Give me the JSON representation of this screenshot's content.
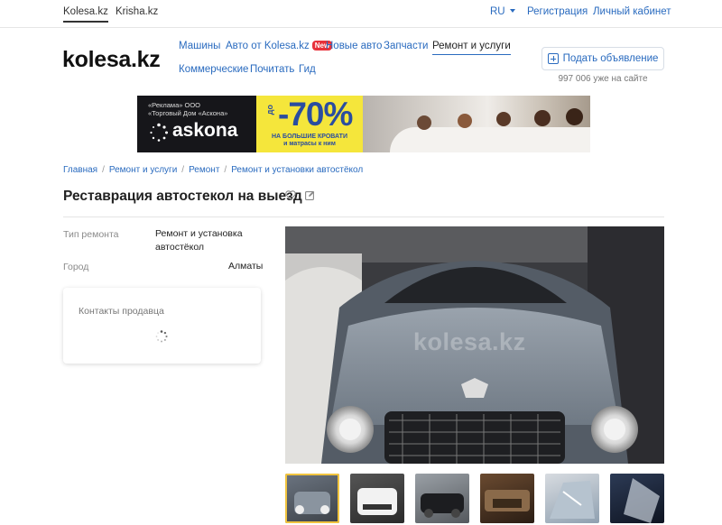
{
  "top_bar": {
    "sites": [
      "Kolesa.kz",
      "Krisha.kz"
    ],
    "language": "RU",
    "register": "Регистрация",
    "account": "Личный кабинет"
  },
  "header": {
    "logo": "kolesa.kz",
    "nav": [
      "Машины",
      "Авто от Kolesa.kz",
      "Новые авто",
      "Запчасти",
      "Ремонт и услуги",
      "Коммерческие",
      "Почитать",
      "Гид"
    ],
    "new_badge": "New",
    "post_button": "Подать объявление",
    "online_count": "997 006 уже на сайте"
  },
  "ad_banner": {
    "small_text_1": "«Реклама» ООО",
    "small_text_2": "«Торговый Дом «Аскона»",
    "brand": "askona",
    "discount_prefix": "до",
    "discount": "-70%",
    "subtitle_1": "НА БОЛЬШИЕ КРОВАТИ",
    "subtitle_2": "и матрасы к ним"
  },
  "breadcrumbs": [
    "Главная",
    "Ремонт и услуги",
    "Ремонт",
    "Ремонт и установки автостёкол"
  ],
  "listing": {
    "title": "Реставрация автостекол на выезд",
    "params": [
      {
        "label": "Тип ремонта",
        "value_line1": "Ремонт и установка",
        "value_line2": "автостёкол"
      },
      {
        "label": "Город",
        "value_line1": "Алматы",
        "value_line2": ""
      }
    ],
    "contacts_label": "Контакты продавца",
    "watermark": "kolesa.kz",
    "thumbnail_count": 6,
    "active_thumbnail": 1
  },
  "colors": {
    "link": "#2a6bbf",
    "badge": "#e7313b",
    "ad_yellow": "#f5e63b",
    "active_thumb": "#f1c43f"
  }
}
